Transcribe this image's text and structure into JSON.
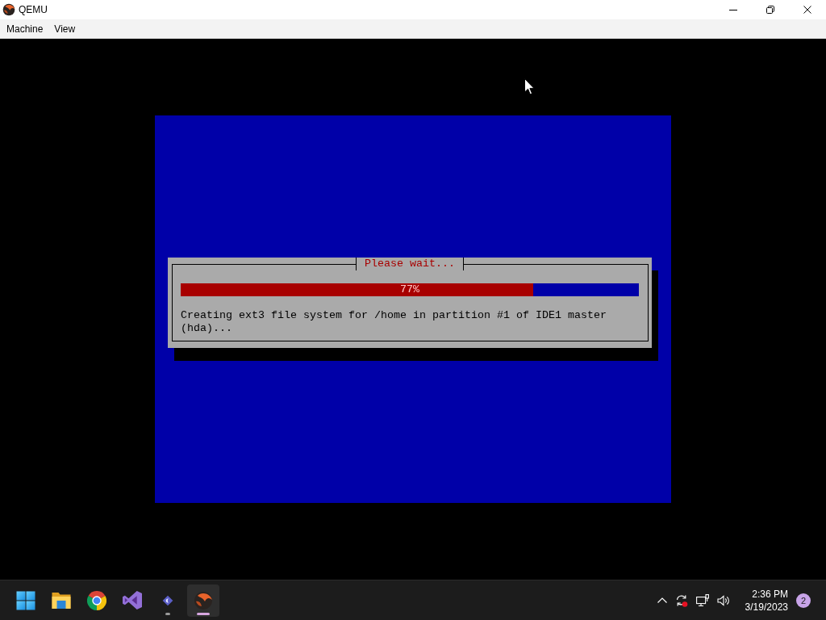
{
  "window": {
    "title": "QEMU",
    "menu": [
      {
        "label": "Machine"
      },
      {
        "label": "View"
      }
    ]
  },
  "guest_screen": {
    "dialog": {
      "title": "Please wait...",
      "progress": {
        "level": 0.77,
        "reading": "77%"
      },
      "message": "Creating ext3 file system for /home in partition #1 of IDE1 master (hda)..."
    }
  },
  "taskbar": {
    "apps": [
      {
        "kind": "start",
        "running": false,
        "active": false
      },
      {
        "kind": "folder",
        "running": false,
        "active": false
      },
      {
        "kind": "browser",
        "running": false,
        "active": false
      },
      {
        "kind": "editor",
        "running": false,
        "active": false
      },
      {
        "kind": "chat",
        "running": true,
        "active": false
      },
      {
        "kind": "emulator",
        "running": true,
        "active": true
      }
    ],
    "clock": {
      "time": "2:36 PM",
      "date": "3/19/2023"
    },
    "notifications": "2"
  }
}
